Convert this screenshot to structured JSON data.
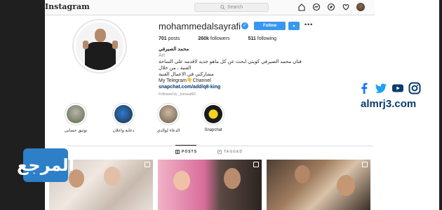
{
  "topbar": {
    "logo": "Instagram",
    "search_placeholder": "Search"
  },
  "profile": {
    "username": "mohammedalsayrafi",
    "verified_mark": "✓",
    "follow_label": "Follow",
    "dropdown_label": "▾",
    "more_label": "•••",
    "stats": {
      "posts": "701",
      "posts_label": "posts",
      "followers": "260k",
      "followers_label": "followers",
      "following": "511",
      "following_label": "following"
    },
    "bio": {
      "name": "محمد الصيرفي",
      "category": "Art",
      "line1": "فنان محمد الصيرفي كويتي ابحث عن كل ماهو جديد لاقدمه على الساحة الفنية ، من خلال",
      "line2": "مشاركتي في الاعمال الفنية",
      "line3": "My Telegram👇Channel",
      "link": "snapchat.com/add/q8-king",
      "followed_by": "Followed by _lurnaad92"
    }
  },
  "highlights": [
    {
      "label": "توثيق حسابي"
    },
    {
      "label": "دعاية واعلان"
    },
    {
      "label": "الدعاء لوالدي"
    },
    {
      "label": "Snapchat"
    }
  ],
  "tabs": {
    "posts": "POSTS",
    "tagged": "TAGGED"
  },
  "watermark": {
    "logo_text": "المرجع",
    "site": "almrj3.com"
  },
  "colors": {
    "accent": "#3897f0",
    "facebook": "#1877f2",
    "twitter": "#1da1f2",
    "youtube": "#0b3c6e",
    "instagram": "#0b3c6e",
    "site_text": "#0b3c6e",
    "logo_bg": "#2d7fc7"
  },
  "icons": [
    "search-icon",
    "home-icon",
    "messenger-icon",
    "explore-icon",
    "heart-icon",
    "facebook-icon",
    "twitter-icon",
    "youtube-icon",
    "instagram-icon"
  ]
}
